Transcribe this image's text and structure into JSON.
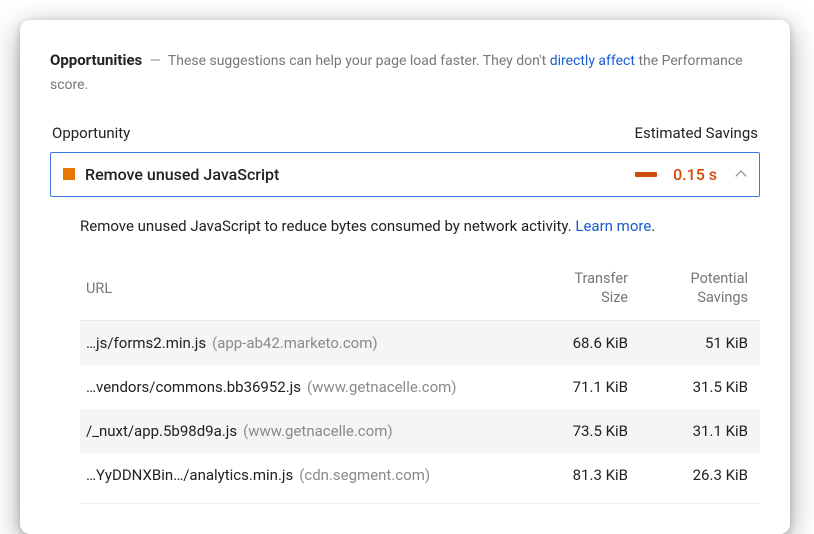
{
  "header": {
    "title": "Opportunities",
    "dash": "—",
    "desc_a": "These suggestions can help your page load faster. They don't",
    "link": "directly affect",
    "desc_b": "the Performance score."
  },
  "cols": {
    "left": "Opportunity",
    "right": "Estimated Savings"
  },
  "accordion": {
    "title": "Remove unused JavaScript",
    "savings": "0.15 s"
  },
  "desc": {
    "text": "Remove unused JavaScript to reduce bytes consumed by network activity.",
    "learn": "Learn more",
    "dot": "."
  },
  "thead": {
    "url": "URL",
    "size_a": "Transfer",
    "size_b": "Size",
    "sav_a": "Potential",
    "sav_b": "Savings"
  },
  "rows": [
    {
      "path": "…js/forms2.min.js",
      "host": "(app-ab42.marketo.com)",
      "size": "68.6 KiB",
      "sav": "51 KiB"
    },
    {
      "path": "…vendors/commons.bb36952.js",
      "host": "(www.getnacelle.com)",
      "size": "71.1 KiB",
      "sav": "31.5 KiB"
    },
    {
      "path": "/_nuxt/app.5b98d9a.js",
      "host": "(www.getnacelle.com)",
      "size": "73.5 KiB",
      "sav": "31.1 KiB"
    },
    {
      "path": "…YyDDNXBin…/analytics.min.js",
      "host": "(cdn.segment.com)",
      "size": "81.3 KiB",
      "sav": "26.3 KiB"
    }
  ]
}
